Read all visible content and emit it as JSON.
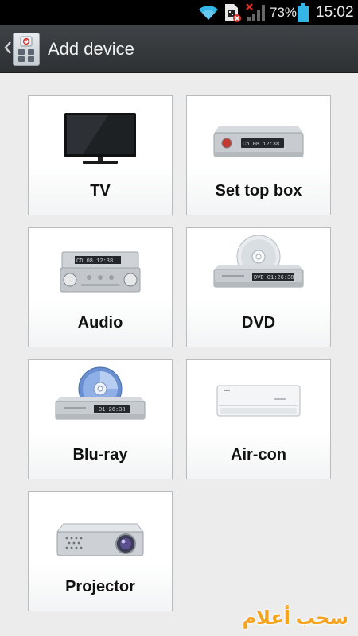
{
  "status_bar": {
    "battery_percent": "73%",
    "time": "15:02",
    "icons": [
      "wifi-icon",
      "sim-missing-icon",
      "no-signal-icon",
      "battery-icon"
    ]
  },
  "action_bar": {
    "title": "Add device",
    "icons": [
      "back-chevron-icon",
      "remote-app-icon"
    ]
  },
  "devices": [
    {
      "label": "TV",
      "icon": "tv-icon"
    },
    {
      "label": "Set top box",
      "icon": "set-top-box-icon",
      "display_text": "Ch 08 12:38"
    },
    {
      "label": "Audio",
      "icon": "audio-icon",
      "display_text": "CD 08 12:38"
    },
    {
      "label": "DVD",
      "icon": "dvd-icon",
      "display_text": "DVD 01:26:38"
    },
    {
      "label": "Blu-ray",
      "icon": "blu-ray-icon",
      "display_text": "01:26:38"
    },
    {
      "label": "Air-con",
      "icon": "air-con-icon"
    },
    {
      "label": "Projector",
      "icon": "projector-icon"
    }
  ],
  "watermark": "سحب أعلام",
  "colors": {
    "status_bar_bg": "#000000",
    "action_bar_bg": "#35383b",
    "content_bg": "#ececec",
    "tile_border": "#b9bcbf",
    "battery": "#33b5e5"
  }
}
